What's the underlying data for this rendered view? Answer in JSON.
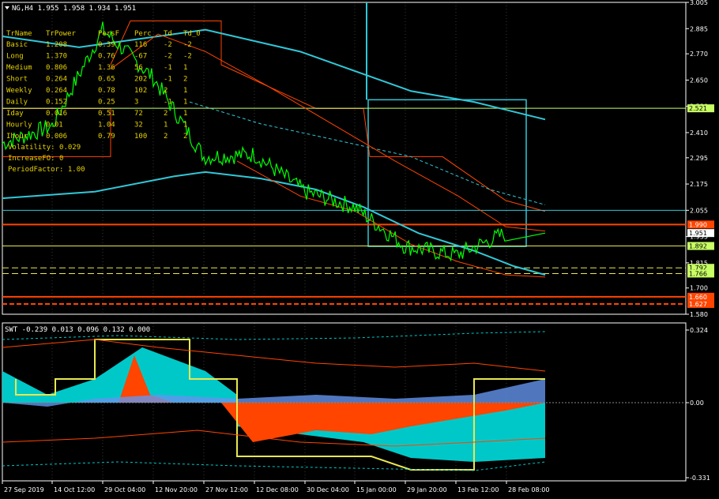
{
  "header": {
    "symbol_line": "NG,H4  1.955 1.958 1.934 1.951",
    "indicator_line": "SWT -0.239 0.013 0.096 0.132 0.000"
  },
  "colors": {
    "background": "#000000",
    "grid": "#2f3a2f",
    "price": "#00ff00",
    "ma": "#30c8d8",
    "ma_dash": "#30c8d8",
    "orange_line": "#ff4500",
    "yellow_line": "#e8e850",
    "fill_orange": "#ff4500",
    "fill_cyan": "#00c8c8",
    "fill_blue": "#6495ed",
    "table_text": "#e6d200"
  },
  "table": {
    "headers": [
      "TrName",
      "TrPower",
      "PersF",
      "Perc",
      "Td",
      "Td_0"
    ],
    "rows": [
      [
        "Basic",
        "1.208",
        "0.39",
        "116",
        "-2",
        "-2"
      ],
      [
        "Long",
        "1.370",
        "0.76",
        "-67",
        "-2",
        "-2"
      ],
      [
        "Medium",
        "0.806",
        "1.36",
        "56",
        "-1",
        "1"
      ],
      [
        "Short",
        "0.264",
        "0.65",
        "202",
        "-1",
        "2"
      ],
      [
        "Weekly",
        "0.264",
        "0.78",
        "102",
        "2",
        "1"
      ],
      [
        "Daily",
        "0.152",
        "0.25",
        "3",
        "-1",
        "1"
      ],
      [
        "Iday",
        "0.016",
        "0.51",
        "72",
        "2",
        "1"
      ],
      [
        "Hourly",
        "0.01",
        "1.04",
        "32",
        "1",
        "1"
      ],
      [
        "Ihour",
        "0.006",
        "0.79",
        "100",
        "2",
        "2"
      ]
    ],
    "volatility": "Volatility: 0.029",
    "increase": "IncreaseFO: 0",
    "period": "PeriodFactor: 1.00"
  },
  "price_axis": {
    "ticks": [
      "3.005",
      "2.885",
      "2.770",
      "2.650",
      "2.530",
      "2.410",
      "2.295",
      "2.175",
      "2.055",
      "1.935",
      "1.815",
      "1.700",
      "1.580"
    ],
    "markers": [
      {
        "text": "2.521",
        "bg": "#c8ff64",
        "fg": "#000000"
      },
      {
        "text": "1.990",
        "bg": "#ff4500",
        "fg": "#ffffff"
      },
      {
        "text": "1.951",
        "bg": "#ffffff",
        "fg": "#000000"
      },
      {
        "text": "1.892",
        "bg": "#c8ff64",
        "fg": "#000000"
      },
      {
        "text": "1.792",
        "bg": "#c8ff64",
        "fg": "#000000"
      },
      {
        "text": "1.766",
        "bg": "#c8ff64",
        "fg": "#000000"
      },
      {
        "text": "1.660",
        "bg": "#ff4500",
        "fg": "#ffffff"
      },
      {
        "text": "1.627",
        "bg": "#ff4500",
        "fg": "#ffffff"
      }
    ]
  },
  "osc_axis": {
    "ticks": [
      "0.324",
      "0.00",
      "-0.331"
    ]
  },
  "time_axis": {
    "labels": [
      "27 Sep 2019",
      "14 Oct 12:00",
      "29 Oct 04:00",
      "12 Nov 20:00",
      "27 Nov 12:00",
      "12 Dec 08:00",
      "30 Dec 04:00",
      "15 Jan 00:00",
      "29 Jan 20:00",
      "13 Feb 12:00",
      "28 Feb 08:00"
    ]
  },
  "chart_data": {
    "type": "line",
    "title": "NG,H4",
    "ylim": [
      1.58,
      3.005
    ],
    "series": [
      {
        "name": "NG,H4",
        "x": [
          "27 Sep 2019",
          "14 Oct 12:00",
          "29 Oct 04:00",
          "12 Nov 20:00",
          "27 Nov 12:00",
          "12 Dec 08:00",
          "30 Dec 04:00",
          "15 Jan 00:00",
          "29 Jan 20:00",
          "13 Feb 12:00",
          "28 Feb 08:00"
        ],
        "values": [
          2.36,
          2.44,
          2.88,
          2.66,
          2.3,
          2.31,
          2.14,
          2.07,
          1.89,
          1.85,
          1.951
        ]
      }
    ]
  }
}
